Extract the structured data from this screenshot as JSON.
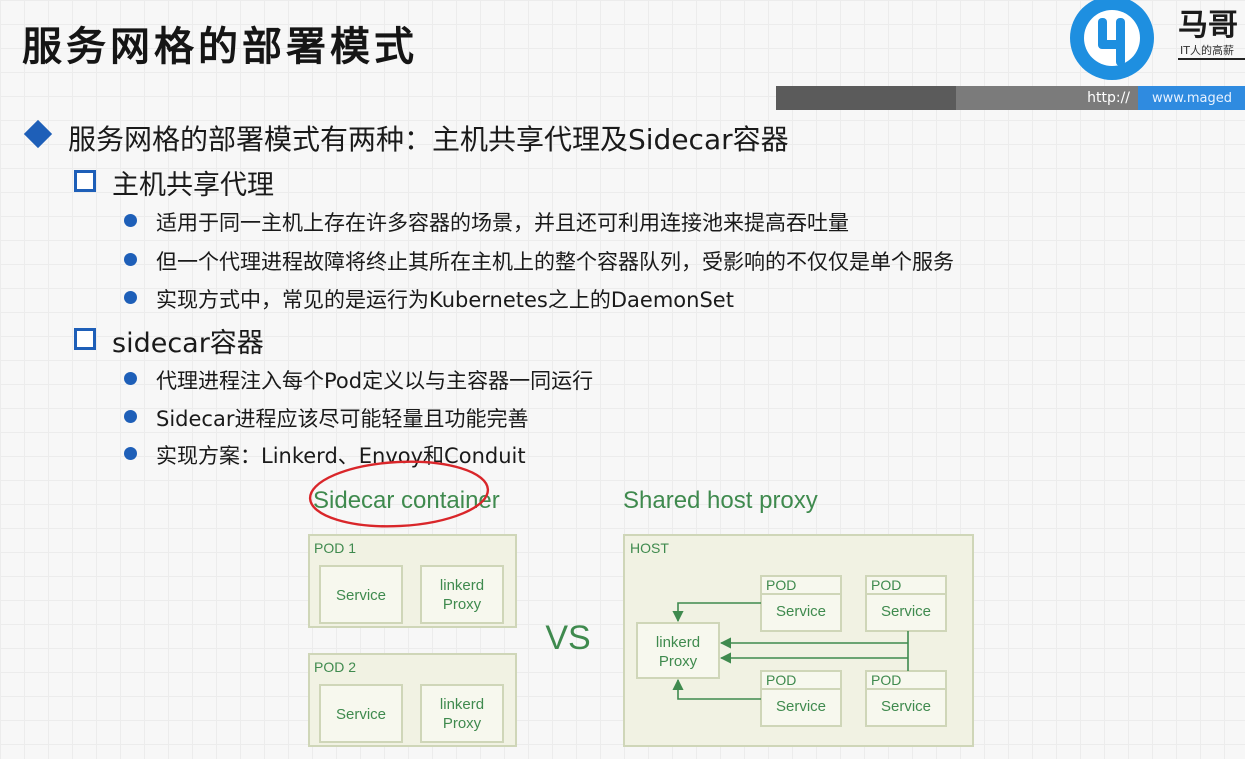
{
  "slide": {
    "title": "服务网格的部署模式",
    "logo_text": "马哥",
    "logo_sub": "IT人的高薪",
    "url_prefix": "http://",
    "url_site": "www.maged"
  },
  "content": {
    "heading": "服务网格的部署模式有两种：主机共享代理及Sidecar容器",
    "sections": [
      {
        "title": "主机共享代理",
        "bullets": [
          "适用于同一主机上存在许多容器的场景，并且还可利用连接池来提高吞吐量",
          "但一个代理进程故障将终止其所在主机上的整个容器队列，受影响的不仅仅是单个服务",
          "实现方式中，常见的是运行为Kubernetes之上的DaemonSet"
        ]
      },
      {
        "title": "sidecar容器",
        "bullets": [
          "代理进程注入每个Pod定义以与主容器一同运行",
          "Sidecar进程应该尽可能轻量且功能完善",
          "实现方案：Linkerd、Envoy和Conduit"
        ]
      }
    ]
  },
  "diagram": {
    "left_title": "Sidecar container",
    "right_title": "Shared host proxy",
    "vs": "VS",
    "pods": [
      {
        "label": "POD 1",
        "service": "Service",
        "proxy_line1": "linkerd",
        "proxy_line2": "Proxy"
      },
      {
        "label": "POD 2",
        "service": "Service",
        "proxy_line1": "linkerd",
        "proxy_line2": "Proxy"
      }
    ],
    "host": {
      "label": "HOST",
      "proxy_line1": "linkerd",
      "proxy_line2": "Proxy",
      "pod_label": "POD",
      "service": "Service"
    },
    "colors": {
      "green": "#3f8a4e",
      "box_fill": "#f1f2e3",
      "border": "#cfd6b8",
      "annotation": "#d9262a",
      "bullet": "#1e5fb8"
    }
  }
}
